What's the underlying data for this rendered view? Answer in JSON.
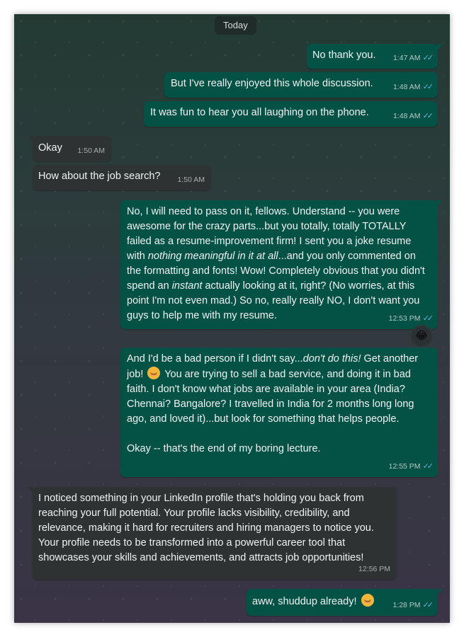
{
  "chat": {
    "date_label": "Today",
    "messages": [
      {
        "id": "m1",
        "direction": "outgoing",
        "text": "No thank you.",
        "time": "1:47 AM"
      },
      {
        "id": "m2",
        "direction": "outgoing",
        "text": "But I've really enjoyed this whole discussion.",
        "time": "1:48 AM"
      },
      {
        "id": "m3",
        "direction": "outgoing",
        "text": "It was fun to hear you all laughing on the phone.",
        "time": "1:48 AM"
      },
      {
        "id": "m4",
        "direction": "incoming",
        "text": "Okay",
        "time": "1:50 AM"
      },
      {
        "id": "m5",
        "direction": "incoming",
        "text": "How about the job search?",
        "time": "1:50 AM"
      },
      {
        "id": "m6",
        "direction": "outgoing",
        "time": "12:53 PM",
        "reaction": "😂",
        "parts": {
          "a": "No, I will need to pass on it, fellows.  Understand -- you were awesome for the crazy parts...but you totally, totally TOTALLY failed as a resume-improvement firm!  I sent you a joke resume with ",
          "b": "nothing meaningful in it at all",
          "c": "...and you only commented on the formatting and fonts!  Wow!  Completely obvious that you didn't spend an ",
          "d": "instant",
          "e": " actually looking at it, right?  (No worries, at this point I'm not even mad.)  So no, really really NO, I don't want you guys to help me with my resume."
        }
      },
      {
        "id": "m7",
        "direction": "outgoing",
        "time": "12:55 PM",
        "parts": {
          "a": "And I'd be a bad person if I didn't say...",
          "b": "don't do this!",
          "c": "  Get another job!",
          "d": "  You are trying to sell a bad service, and doing it in bad faith.  I don't know what jobs are available in your area (India? Chennai?  Bangalore? I travelled in India for 2 months long long ago, and loved it)...but look for something that helps people.",
          "e": "Okay -- that's the end of my boring lecture."
        }
      },
      {
        "id": "m8",
        "direction": "incoming",
        "time": "12:56 PM",
        "text": "I noticed something in your LinkedIn profile that's holding you back from reaching your full potential. Your profile lacks visibility, credibility, and relevance, making it hard for recruiters and hiring managers to notice you. Your profile needs to be transformed into a powerful career tool that showcases your skills and achievements, and attracts job opportunities!"
      },
      {
        "id": "m9",
        "direction": "outgoing",
        "text": "aww, shuddup already!",
        "time": "1:28 PM"
      }
    ]
  },
  "colors": {
    "outgoing_bubble": "#045145",
    "incoming_bubble": "#2e3233",
    "read_ticks": "#5fb8e6"
  },
  "icons": {
    "read_receipt": "double-check-icon",
    "smile": "smiling-face-emoji",
    "laugh": "tears-of-joy-emoji"
  }
}
